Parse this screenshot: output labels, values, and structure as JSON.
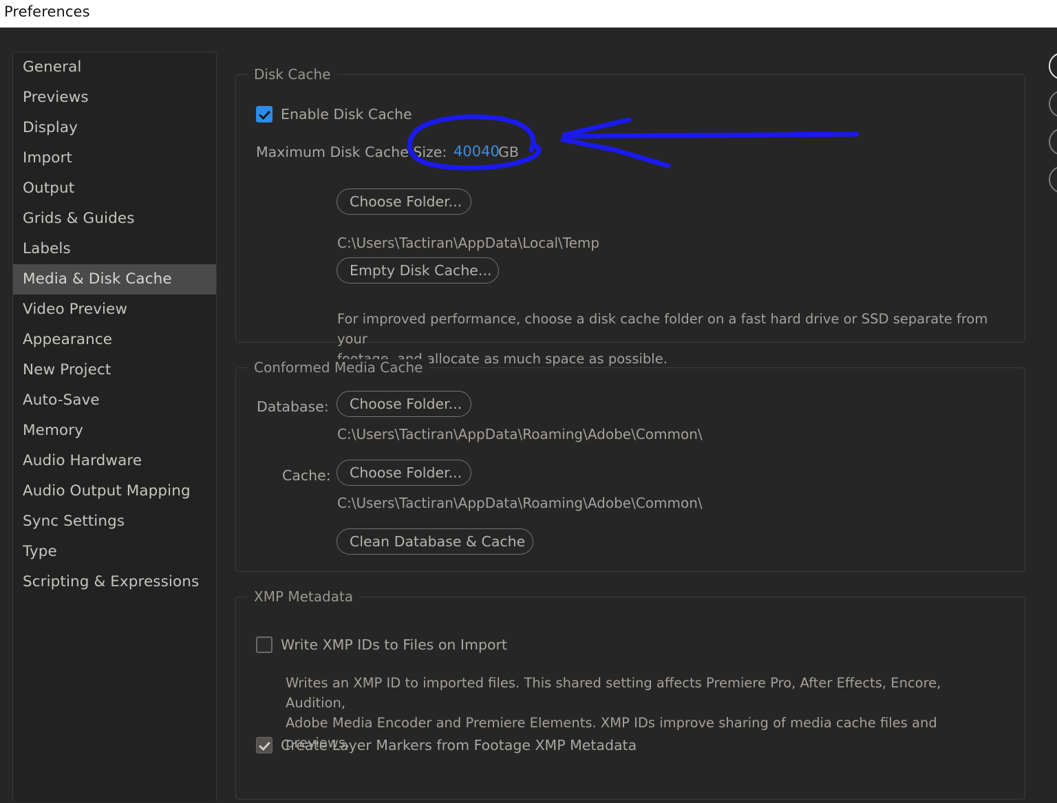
{
  "window": {
    "title": "Preferences"
  },
  "sidebar": {
    "items": [
      {
        "label": "General",
        "selected": false
      },
      {
        "label": "Previews",
        "selected": false
      },
      {
        "label": "Display",
        "selected": false
      },
      {
        "label": "Import",
        "selected": false
      },
      {
        "label": "Output",
        "selected": false
      },
      {
        "label": "Grids & Guides",
        "selected": false
      },
      {
        "label": "Labels",
        "selected": false
      },
      {
        "label": "Media & Disk Cache",
        "selected": true
      },
      {
        "label": "Video Preview",
        "selected": false
      },
      {
        "label": "Appearance",
        "selected": false
      },
      {
        "label": "New Project",
        "selected": false
      },
      {
        "label": "Auto-Save",
        "selected": false
      },
      {
        "label": "Memory",
        "selected": false
      },
      {
        "label": "Audio Hardware",
        "selected": false
      },
      {
        "label": "Audio Output Mapping",
        "selected": false
      },
      {
        "label": "Sync Settings",
        "selected": false
      },
      {
        "label": "Type",
        "selected": false
      },
      {
        "label": "Scripting & Expressions",
        "selected": false
      }
    ]
  },
  "disk_cache": {
    "legend": "Disk Cache",
    "enable_label": "Enable Disk Cache",
    "enable_checked": true,
    "max_size_label": "Maximum Disk Cache Size:",
    "max_size_value": "40040",
    "max_size_unit": "GB",
    "choose_folder_label": "Choose Folder...",
    "folder_path": "C:\\Users\\Tactiran\\AppData\\Local\\Temp",
    "empty_cache_label": "Empty Disk Cache...",
    "description_line1": "For improved performance, choose a disk cache folder on a fast hard drive or SSD separate from your",
    "description_line2": "footage, and allocate as much space as possible."
  },
  "conformed_media_cache": {
    "legend": "Conformed Media Cache",
    "database_label": "Database:",
    "database_button": "Choose Folder...",
    "database_path": "C:\\Users\\Tactiran\\AppData\\Roaming\\Adobe\\Common\\",
    "cache_label": "Cache:",
    "cache_button": "Choose Folder...",
    "cache_path": "C:\\Users\\Tactiran\\AppData\\Roaming\\Adobe\\Common\\",
    "clean_button": "Clean Database & Cache"
  },
  "xmp_metadata": {
    "legend": "XMP Metadata",
    "write_ids_label": "Write XMP IDs to Files on Import",
    "write_ids_checked": false,
    "write_ids_desc_line1": "Writes an XMP ID to imported files. This shared setting affects Premiere Pro, After Effects, Encore, Audition,",
    "write_ids_desc_line2": "Adobe Media Encoder and Premiere Elements. XMP IDs improve sharing of media cache files and previews.",
    "layer_markers_label": "Create Layer Markers from Footage XMP Metadata",
    "layer_markers_checked": true
  },
  "annotation": {
    "color": "#1a1aee",
    "shapes": [
      "ellipse-around-max-cache-size",
      "arrow-pointing-left-at-value"
    ]
  },
  "colors": {
    "accent_checkbox": "#2d8ceb",
    "hot_value": "#3d8ce0",
    "dialog_bg": "#262626",
    "sidebar_bg": "#222222",
    "selection_bg": "#4a4a4a",
    "annotation": "#1a1aee"
  }
}
